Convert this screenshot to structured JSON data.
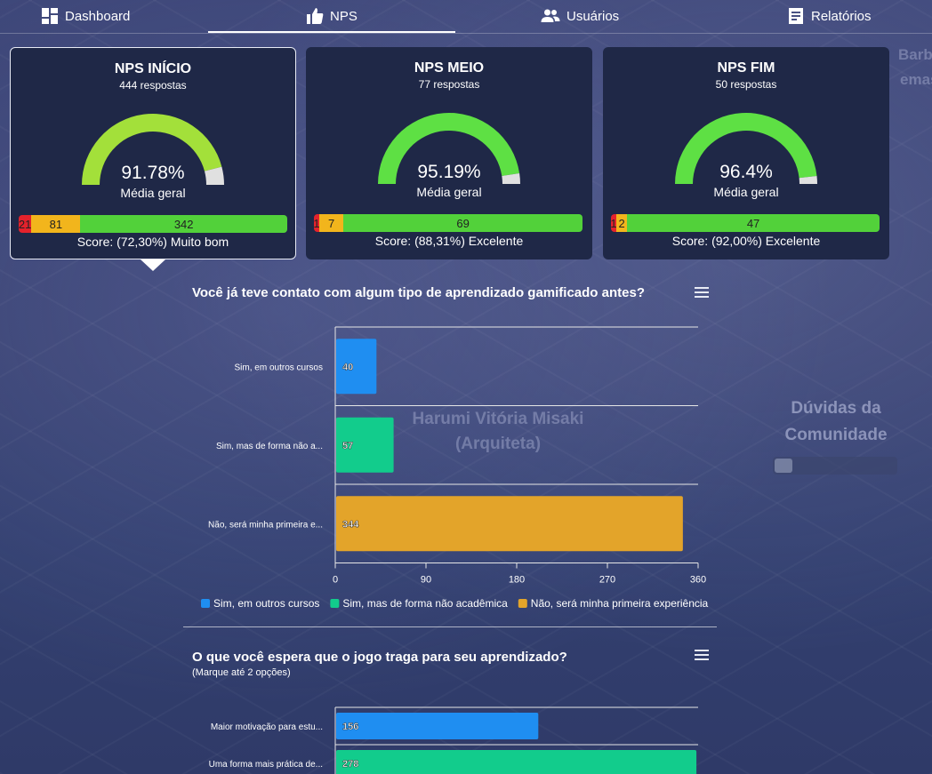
{
  "nav": {
    "items": [
      {
        "label": "Dashboard",
        "icon": "dashboard-icon"
      },
      {
        "label": "NPS",
        "icon": "thumbs-up-icon"
      },
      {
        "label": "Usuários",
        "icon": "users-icon"
      },
      {
        "label": "Relatórios",
        "icon": "report-icon"
      }
    ],
    "active": "NPS"
  },
  "background": {
    "avatar_name": "Harumi Vitória Misaki",
    "avatar_role": "(Arquiteta)",
    "community_label": "Dúvidas da Comunidade",
    "partial_text_1": "Barbo",
    "partial_text_2": "emas"
  },
  "cards": [
    {
      "title": "NPS INÍCIO",
      "responses": "444 respostas",
      "value": "91.78%",
      "value_num": 91.78,
      "avg_label": "Média geral",
      "gauge_color": "#a3e03a",
      "segments": {
        "red": "21",
        "yellow": "81",
        "green": "342"
      },
      "shares": [
        21,
        81,
        342
      ],
      "score": "Score: (72,30%) Muito bom"
    },
    {
      "title": "NPS MEIO",
      "responses": "77 respostas",
      "value": "95.19%",
      "value_num": 95.19,
      "avg_label": "Média geral",
      "gauge_color": "#5ee044",
      "segments": {
        "red": "1",
        "yellow": "7",
        "green": "69"
      },
      "shares": [
        1,
        7,
        69
      ],
      "score": "Score: (88,31%) Excelente"
    },
    {
      "title": "NPS FIM",
      "responses": "50 respostas",
      "value": "96.4%",
      "value_num": 96.4,
      "avg_label": "Média geral",
      "gauge_color": "#5ee044",
      "segments": {
        "red": "1",
        "yellow": "2",
        "green": "47"
      },
      "shares": [
        1,
        2,
        47
      ],
      "score": "Score: (92,00%) Excelente"
    }
  ],
  "colors": {
    "blue": "#1f8ef1",
    "teal": "#12cc8c",
    "orange": "#e3a42a",
    "red": "#e4222c",
    "yellow": "#f2b51c",
    "green": "#52d13a"
  },
  "chart_data": [
    {
      "type": "bar",
      "orientation": "horizontal",
      "title": "Você já teve contato com algum tipo de aprendizado gamificado antes?",
      "categories": [
        "Sim, em outros cursos",
        "Sim, mas de forma não a...",
        "Não, será minha primeira e..."
      ],
      "values": [
        40,
        57,
        344
      ],
      "colors": [
        "#1f8ef1",
        "#12cc8c",
        "#e3a42a"
      ],
      "xlim": [
        0,
        360
      ],
      "xticks": [
        "0",
        "90",
        "180",
        "270",
        "360"
      ],
      "legend": [
        "Sim, em outros cursos",
        "Sim, mas de forma não acadêmica",
        "Não, será minha primeira experiência"
      ],
      "legend_position": "bottom",
      "grid": true
    },
    {
      "type": "bar",
      "orientation": "horizontal",
      "title": "O que você espera que o jogo traga para seu aprendizado?",
      "subtitle": "(Marque até 2 opções)",
      "categories": [
        "Maior motivação para estu...",
        "Uma forma mais prática de..."
      ],
      "values": [
        156,
        278
      ],
      "colors": [
        "#1f8ef1",
        "#12cc8c"
      ],
      "xlim": [
        0,
        280
      ],
      "grid": true
    }
  ]
}
